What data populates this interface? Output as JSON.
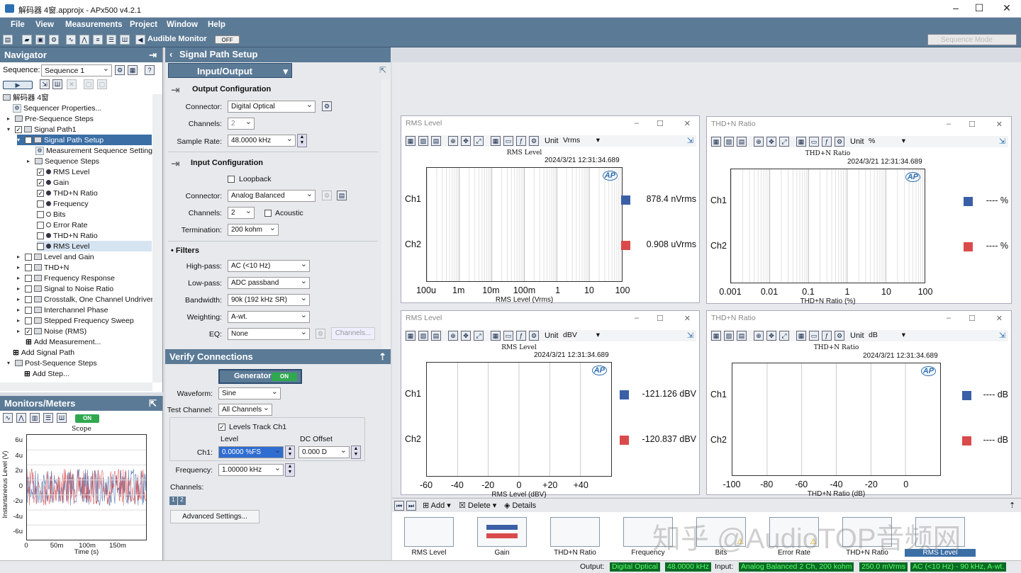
{
  "window": {
    "title": "解码器 4窗.approjx - APx500 v4.2.1"
  },
  "menu": [
    "File",
    "View",
    "Measurements",
    "Project",
    "Window",
    "Help"
  ],
  "toolbar": {
    "audible_monitor": "Audible Monitor",
    "audible_state": "OFF",
    "sequence_mode": "Sequence Mode"
  },
  "navigator": {
    "title": "Navigator",
    "sequence_label": "Sequence:",
    "sequence_value": "Sequence 1",
    "tree": [
      "解码器 4窗",
      "Sequencer Properties...",
      "Pre-Sequence Steps",
      "Signal Path1",
      "Signal Path Setup",
      "Measurement Sequence Settings...",
      "Sequence Steps",
      "RMS Level",
      "Gain",
      "THD+N Ratio",
      "Frequency",
      "Bits",
      "Error Rate",
      "THD+N Ratio",
      "RMS Level",
      "Level and Gain",
      "THD+N",
      "Frequency Response",
      "Signal to Noise Ratio",
      "Crosstalk, One Channel Undriven",
      "Interchannel Phase",
      "Stepped Frequency Sweep",
      "Noise (RMS)",
      "Add Measurement...",
      "Add Signal Path",
      "Post-Sequence Steps",
      "Add Step..."
    ]
  },
  "monitors": {
    "title": "Monitors/Meters",
    "state": "ON",
    "scope_title": "Scope",
    "ylabel": "Instantaneous Level (V)",
    "xlabel": "Time (s)",
    "yticks": [
      "6u",
      "4u",
      "2u",
      "0",
      "-2u",
      "-4u",
      "-6u"
    ],
    "xticks": [
      "0",
      "50m",
      "100m",
      "150m"
    ]
  },
  "sps": {
    "title": "Signal Path Setup",
    "mode": "Input/Output",
    "output_config": "Output Configuration",
    "connector_label": "Connector:",
    "out_connector": "Digital Optical",
    "channels_label": "Channels:",
    "out_channels": "2",
    "sample_rate_label": "Sample Rate:",
    "sample_rate": "48.0000 kHz",
    "input_config": "Input Configuration",
    "loopback": "Loopback",
    "in_connector": "Analog Balanced",
    "in_channels": "2",
    "acoustic": "Acoustic",
    "termination_label": "Termination:",
    "termination": "200 kohm",
    "filters": "Filters",
    "highpass_label": "High-pass:",
    "highpass": "AC (<10 Hz)",
    "lowpass_label": "Low-pass:",
    "lowpass": "ADC passband",
    "bandwidth_label": "Bandwidth:",
    "bandwidth": "90k (192 kHz SR)",
    "weighting_label": "Weighting:",
    "weighting": "A-wt.",
    "eq_label": "EQ:",
    "eq": "None",
    "channels_btn": "Channels..."
  },
  "verify": {
    "title": "Verify Connections",
    "generator": "Generator",
    "gen_state": "ON",
    "waveform_label": "Waveform:",
    "waveform": "Sine",
    "test_channel_label": "Test Channel:",
    "test_channel": "All Channels",
    "levels_track": "Levels Track Ch1",
    "level_hdr": "Level",
    "dc_hdr": "DC Offset",
    "ch1_label": "Ch1:",
    "ch1_level": "0.0000 %FS",
    "ch1_dc": "0.000 D",
    "frequency_label": "Frequency:",
    "frequency": "1.00000 kHz",
    "channels_label": "Channels:",
    "advanced": "Advanced Settings..."
  },
  "graphs": [
    {
      "title": "RMS Level",
      "unit": "Vrms",
      "inner": "RMS Level",
      "timestamp": "2024/3/21 12:31:34.689",
      "ch1": "878.4  nVrms",
      "ch2": "0.908  uVrms",
      "xticks": [
        "100u",
        "1m",
        "10m",
        "100m",
        "1",
        "10",
        "100"
      ],
      "xlabel": "RMS Level (Vrms)"
    },
    {
      "title": "THD+N Ratio",
      "unit": "%",
      "inner": "THD+N Ratio",
      "timestamp": "2024/3/21 12:31:34.689",
      "ch1": "---- %",
      "ch2": "---- %",
      "xticks": [
        "0.001",
        "0.01",
        "0.1",
        "1",
        "10",
        "100"
      ],
      "xlabel": "THD+N Ratio (%)"
    },
    {
      "title": "RMS Level",
      "unit": "dBV",
      "inner": "RMS Level",
      "timestamp": "2024/3/21 12:31:34.689",
      "ch1": "-121.126  dBV",
      "ch2": "-120.837  dBV",
      "xticks": [
        "-60",
        "-40",
        "-20",
        "0",
        "+20",
        "+40"
      ],
      "xlabel": "RMS Level (dBV)"
    },
    {
      "title": "THD+N Ratio",
      "unit": "dB",
      "inner": "THD+N Ratio",
      "timestamp": "2024/3/21 12:31:34.689",
      "ch1": "---- dB",
      "ch2": "---- dB",
      "xticks": [
        "-100",
        "-80",
        "-60",
        "-40",
        "-20",
        "0"
      ],
      "xlabel": "THD+N Ratio (dB)"
    }
  ],
  "graph_common": {
    "ch1_label": "Ch1",
    "ch2_label": "Ch2",
    "unit_label": "Unit",
    "logo": "AP",
    "ch1_color": "#3a5fa6",
    "ch2_color": "#d94b4b"
  },
  "strip": {
    "add": "Add",
    "delete": "Delete",
    "details": "Details"
  },
  "thumbs": [
    "RMS Level",
    "Gain",
    "THD+N Ratio",
    "Frequency",
    "Bits",
    "Error Rate",
    "THD+N Ratio",
    "RMS Level"
  ],
  "watermark": "知乎 @AudioTOP音频网",
  "status": {
    "output_label": "Output:",
    "output": "Digital Optical",
    "output_rate": "48.0000 kHz",
    "input_label": "Input:",
    "input": "Analog Balanced 2 Ch, 200 kohm",
    "input_level": "250.0 mVrms",
    "input_filter": "AC (<10 Hz) - 90 kHz, A-wt."
  }
}
